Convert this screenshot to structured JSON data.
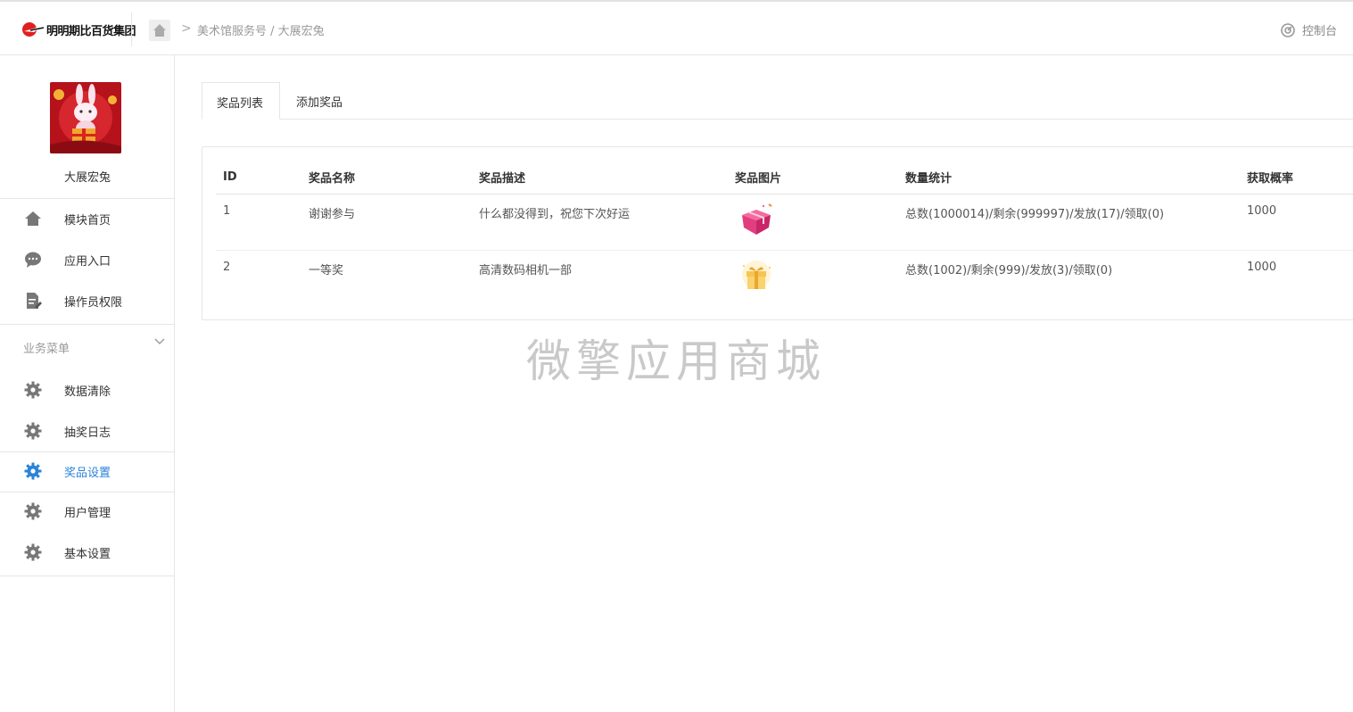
{
  "header": {
    "logo_text": "明明期比百货集团",
    "breadcrumb_separator": ">",
    "breadcrumb": "美术馆服务号 / 大展宏兔",
    "console_label": "控制台"
  },
  "sidebar": {
    "store_name": "大展宏兔",
    "top_items": [
      {
        "label": "模块首页",
        "icon": "home-icon"
      },
      {
        "label": "应用入口",
        "icon": "chat-icon"
      },
      {
        "label": "操作员权限",
        "icon": "document-edit-icon"
      }
    ],
    "section_title": "业务菜单",
    "business_items": [
      {
        "label": "数据清除",
        "icon": "gear-icon",
        "active": false
      },
      {
        "label": "抽奖日志",
        "icon": "gear-icon",
        "active": false
      },
      {
        "label": "奖品设置",
        "icon": "gear-icon",
        "active": true
      },
      {
        "label": "用户管理",
        "icon": "gear-icon",
        "active": false
      },
      {
        "label": "基本设置",
        "icon": "gear-icon",
        "active": false
      }
    ]
  },
  "tabs": [
    {
      "label": "奖品列表",
      "active": true
    },
    {
      "label": "添加奖品",
      "active": false
    }
  ],
  "table": {
    "columns": [
      "ID",
      "奖品名称",
      "奖品描述",
      "奖品图片",
      "数量统计",
      "获取概率"
    ],
    "rows": [
      {
        "id": "1",
        "name": "谢谢参与",
        "desc": "什么都没得到，祝您下次好运",
        "image": "pink-gift-box-icon",
        "stats": "总数(1000014)/剩余(999997)/发放(17)/领取(0)",
        "probability": "1000"
      },
      {
        "id": "2",
        "name": "一等奖",
        "desc": "高清数码相机一部",
        "image": "gold-gift-box-icon",
        "stats": "总数(1002)/剩余(999)/发放(3)/领取(0)",
        "probability": "1000"
      }
    ]
  },
  "watermark": "微擎应用商城",
  "colors": {
    "accent": "#2b83d8",
    "border": "#e6e6e6",
    "icon_gray": "#777777"
  }
}
